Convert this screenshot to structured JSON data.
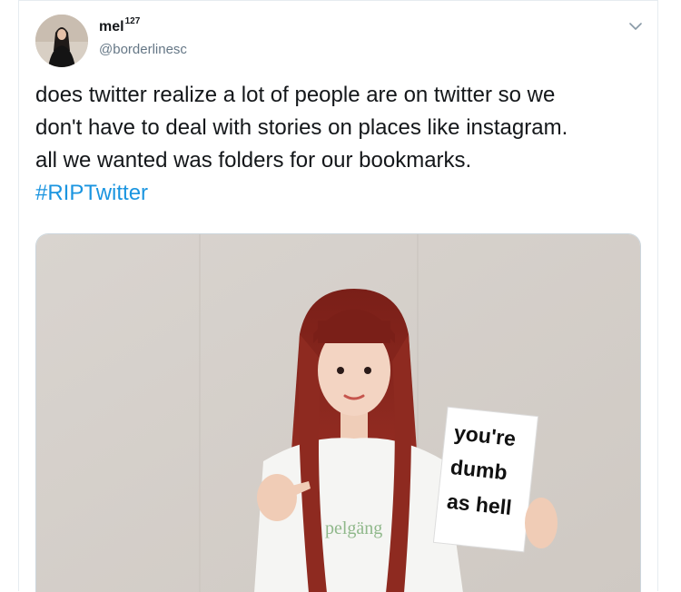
{
  "user": {
    "display_name": "mel",
    "name_superscript": "127",
    "handle": "@borderlinesc"
  },
  "tweet": {
    "lines": [
      "does twitter realize a lot of people are on twitter so we",
      "don't have to deal with stories on places like instagram.",
      "all we wanted was folders for our bookmarks."
    ],
    "hashtag": "#RIPTwitter"
  },
  "media": {
    "sign_lines": [
      "you're",
      "dumb",
      "as hell"
    ],
    "shirt_text": "pelgäng"
  },
  "icons": {
    "caret": "chevron-down-icon"
  },
  "colors": {
    "link": "#1b95e0",
    "text": "#14171a",
    "secondary": "#657786"
  }
}
